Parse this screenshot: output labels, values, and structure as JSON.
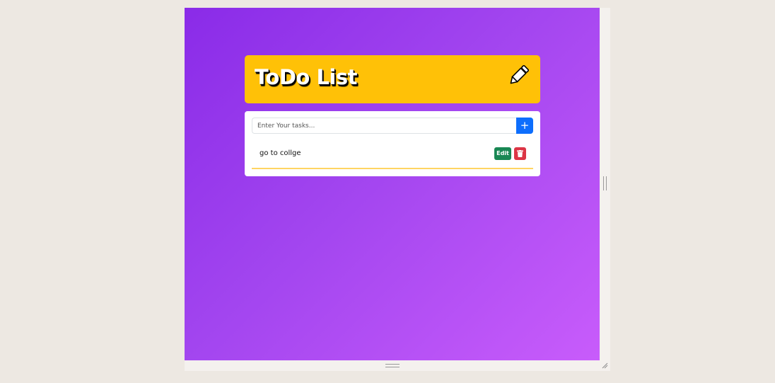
{
  "header": {
    "title": "ToDo List",
    "icon": "pencil-icon",
    "color": "#ffc107"
  },
  "form": {
    "input_placeholder": "Enter Your tasks...",
    "input_value": "",
    "add_label": "+",
    "add_color": "#0d6efd"
  },
  "tasks": [
    {
      "text": "go to collge",
      "edit_label": "Edit",
      "edit_color": "#198754",
      "delete_icon": "trash-icon",
      "delete_color": "#dc3545"
    }
  ],
  "theme": {
    "background_start": "#8a2be8",
    "background_end": "#c85cfb",
    "task_divider": "#ffd563"
  }
}
